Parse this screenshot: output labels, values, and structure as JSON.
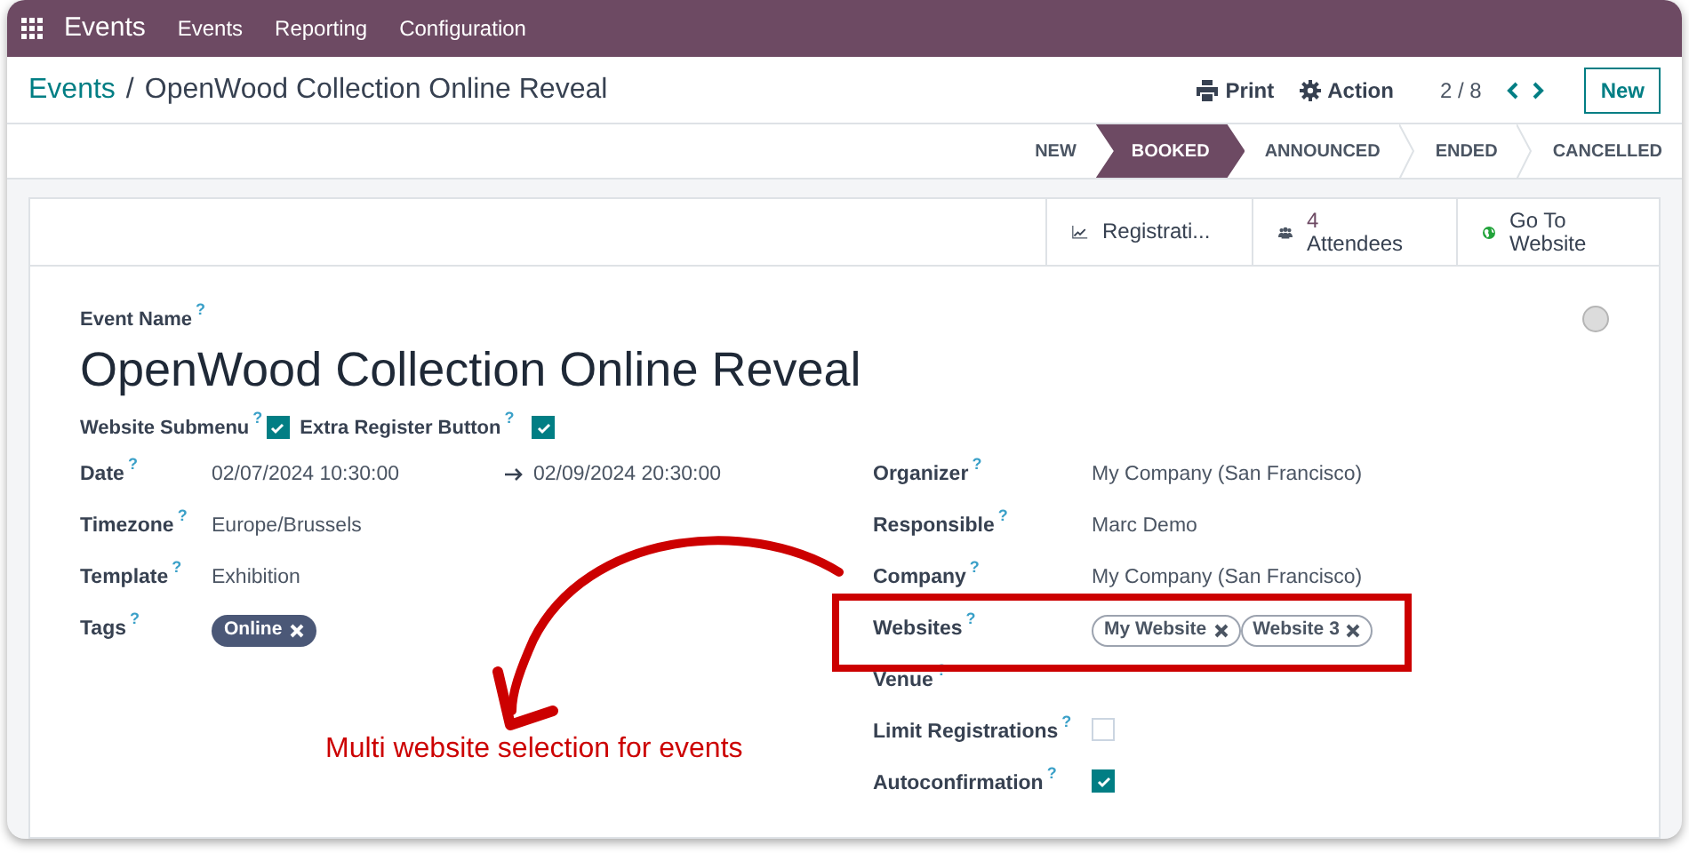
{
  "app_bar": {
    "app_name": "Events",
    "menu": [
      "Events",
      "Reporting",
      "Configuration"
    ]
  },
  "breadcrumb": {
    "parent": "Events",
    "separator": "/",
    "current": "OpenWood Collection Online Reveal"
  },
  "actions": [
    {
      "kind": "print",
      "label": "Print"
    },
    {
      "kind": "gear",
      "label": "Action"
    }
  ],
  "pager": "2 / 8",
  "new_button": "New",
  "stages": [
    {
      "label": "NEW",
      "selected": false
    },
    {
      "label": "BOOKED",
      "selected": true
    },
    {
      "label": "ANNOUNCED",
      "selected": false
    },
    {
      "label": "ENDED",
      "selected": false
    },
    {
      "label": "CANCELLED",
      "selected": false
    }
  ],
  "smart_buttons": [
    {
      "kind": "chart",
      "label": "Registrati..."
    },
    {
      "kind": "people",
      "count": "4",
      "label": "Attendees"
    },
    {
      "kind": "globe",
      "label": "Go To Website"
    }
  ],
  "event_name_label": "Event Name",
  "help_mark": "?",
  "event_name": "OpenWood Collection Online Reveal",
  "flags": [
    {
      "label": "Website Submenu",
      "checked": true
    },
    {
      "label": "Extra Register Button",
      "checked": true
    }
  ],
  "left_fields": [
    {
      "kind": "daterange",
      "label": "Date",
      "start": "02/07/2024 10:30:00",
      "end": "02/09/2024 20:30:00"
    },
    {
      "kind": "text",
      "label": "Timezone",
      "value": "Europe/Brussels"
    },
    {
      "kind": "text",
      "label": "Template",
      "value": "Exhibition"
    },
    {
      "kind": "tags",
      "label": "Tags",
      "tags": [
        "Online"
      ]
    }
  ],
  "right_fields": [
    {
      "kind": "text",
      "label": "Organizer",
      "value": "My Company (San Francisco)"
    },
    {
      "kind": "text",
      "label": "Responsible",
      "value": "Marc Demo"
    },
    {
      "kind": "text",
      "label": "Company",
      "value": "My Company (San Francisco)"
    },
    {
      "kind": "outline_tags",
      "label": "Websites",
      "tags": [
        "My Website",
        "Website 3"
      ]
    },
    {
      "kind": "empty",
      "label": "Venue"
    },
    {
      "kind": "checkbox",
      "label": "Limit Registrations",
      "checked": false
    },
    {
      "kind": "checkbox",
      "label": "Autoconfirmation",
      "checked": true
    }
  ],
  "annotation": "Multi website selection for events"
}
